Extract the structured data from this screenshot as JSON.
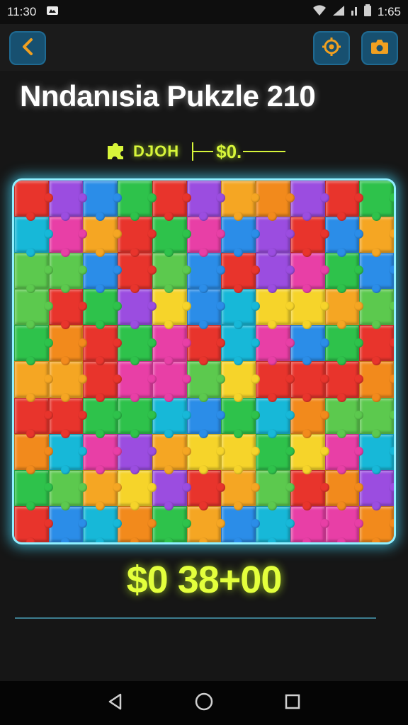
{
  "status": {
    "time": "11:30",
    "battery_time": "1:65"
  },
  "icons": {
    "back": "chevron-left-icon",
    "hint": "target-icon",
    "camera": "camera-icon",
    "puzzle": "puzzle-piece-icon"
  },
  "header": {
    "title": "Nndanısia Pukzle 210"
  },
  "meta": {
    "label": "DJOH",
    "value": "$0."
  },
  "score": {
    "value": "$0 38+00"
  },
  "colors": {
    "accent_neon": "#e3ff3c",
    "board_glow": "#8fefff",
    "button_bg": "#175070",
    "button_icon": "#f0a020"
  },
  "board": {
    "columns": 11,
    "rows": 10,
    "palette": [
      "#f5a623",
      "#2b8de8",
      "#2ec24b",
      "#f6d42a",
      "#e8342c",
      "#9b4de0",
      "#e83fa6",
      "#17b8d8",
      "#f28a1c",
      "#5cc94e"
    ]
  }
}
